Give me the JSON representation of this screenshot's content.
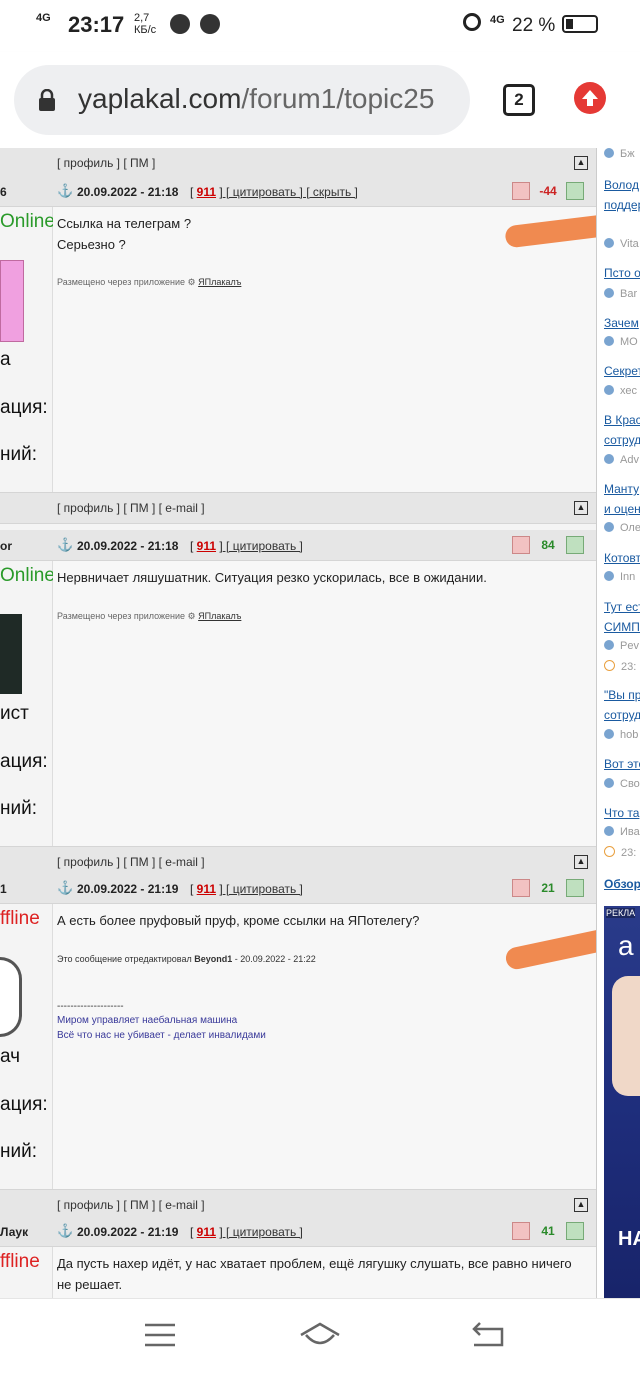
{
  "status_bar": {
    "network": "4G",
    "time": "23:17",
    "speed": "2,7",
    "speed_unit": "КБ/с",
    "network2": "4G",
    "battery": "22 %"
  },
  "browser": {
    "url_domain": "yaplakal.com",
    "url_path": "/forum1/topic25",
    "tab_count": "2"
  },
  "forum": {
    "top_links": "[ профиль ] [ ПМ ]",
    "posts": [
      {
        "nick": "6",
        "status": "Online",
        "date": "20.09.2022 - 21:18",
        "num": "911",
        "actions": " [ цитировать ] [ скрыть ]",
        "rating": "-44",
        "text": "Ссылка на телеграм ?\nСерьезно ?",
        "via_label": "Размещено через приложение",
        "via_app": "ЯПлакалъ",
        "rank": "а",
        "reputation_label": "ация:",
        "posts_label": "ний:",
        "links": "[ профиль ] [ ПМ ] [ e-mail ]"
      },
      {
        "nick": "or",
        "status": "Online",
        "date": "20.09.2022 - 21:18",
        "num": "911",
        "actions": " [ цитировать ]",
        "rating": "84",
        "text": "Нервничает ляшушатник. Ситуация резко ускорилась, все в ожидании.",
        "via_label": "Размещено через приложение",
        "via_app": "ЯПлакалъ",
        "rank": "ист",
        "reputation_label": "ация:",
        "posts_label": "ний:",
        "links": "[ профиль ] [ ПМ ] [ e-mail ]"
      },
      {
        "nick": "1",
        "status": "ffline",
        "date": "20.09.2022 - 21:19",
        "num": "911",
        "actions": " [ цитировать ]",
        "rating": "21",
        "text": "А есть более пруфовый пруф, кроме ссылки на ЯПотелегу?",
        "edited_prefix": "Это сообщение отредактировал",
        "edited_by": "Beyond1",
        "edited_suffix": " - 20.09.2022 - 21:22",
        "separator": "--------------------",
        "sig1": "Миром управляет наебальная машина",
        "sig2": "Всё что нас не убивает - делает инвалидами",
        "rank": "ач",
        "reputation_label": "ация:",
        "posts_label": "ний:",
        "links": "[ профиль ] [ ПМ ] [ e-mail ]"
      },
      {
        "nick": "Лаук",
        "status": "ffline",
        "date": "20.09.2022 - 21:19",
        "num": "911",
        "actions": " [ цитировать ]",
        "rating": "41",
        "text": "Да пусть нахер идёт, у нас хватает проблем, ещё лягушку слушать, все равно ничего не решает."
      }
    ]
  },
  "sidebar": {
    "items": [
      {
        "author": "Бж"
      },
      {
        "title": "Волод",
        "title2": "поддер",
        "author": "Vita"
      },
      {
        "title": "Пстo о",
        "author": "Bar"
      },
      {
        "title": "Зачем",
        "author": "МО"
      },
      {
        "title": "Секрет",
        "author": "хес"
      },
      {
        "title": "В Крас",
        "title2": "сотруд",
        "author": "Adv"
      },
      {
        "title": "Манту",
        "title2": "и оцен",
        "author": "Оле"
      },
      {
        "title": "Котовт",
        "author": "Inn"
      },
      {
        "title": "Тут ест",
        "title2": "СИМПС",
        "author": "Pev",
        "time": "23:"
      },
      {
        "title": "\"Вы пр",
        "title2": "сотруд",
        "author": "hob"
      },
      {
        "title": "Вот это",
        "author": "Сво"
      },
      {
        "title": "Что та",
        "author": "Ива",
        "time": "23:"
      }
    ],
    "overview": "Обзор",
    "ad_label": "РЕКЛА",
    "ad_logo": "а",
    "ad_text": "НА"
  },
  "colors": {
    "online": "#2a9a2a",
    "offline": "#d22222",
    "scribble": "#f08a50",
    "link_blue": "#1a5aa0"
  },
  "icons": [
    "signal-icon",
    "chrome-icon",
    "alarm-icon",
    "battery-icon",
    "lock-icon",
    "tabs-icon",
    "upload-icon",
    "anchor-icon",
    "thumb-down-icon",
    "thumb-up-icon",
    "scroll-top-icon",
    "menu-icon",
    "home-icon",
    "back-icon"
  ]
}
